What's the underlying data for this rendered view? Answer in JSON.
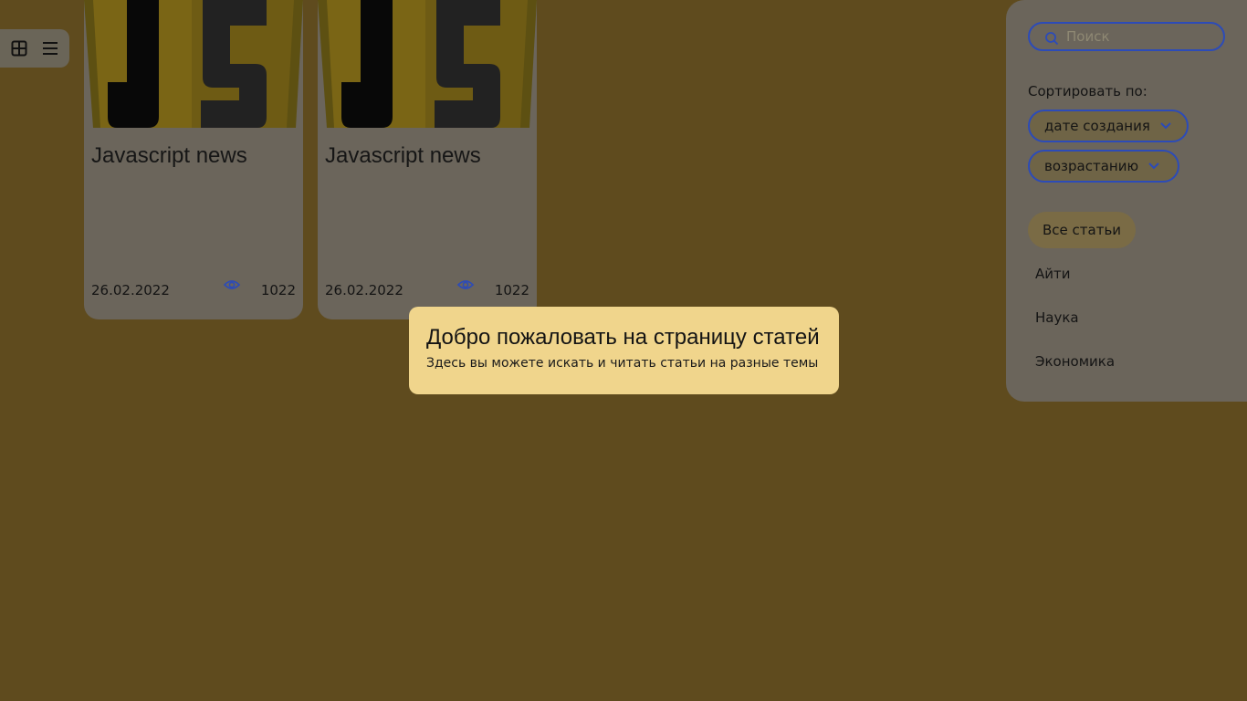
{
  "view_switch": {
    "tile_icon": "grid-view-icon",
    "list_icon": "list-view-icon"
  },
  "articles": [
    {
      "image": "javascript-logo",
      "title": "Javascript news",
      "date": "26.02.2022",
      "views_icon": "eye-icon",
      "views": "1022"
    },
    {
      "image": "javascript-logo",
      "title": "Javascript news",
      "date": "26.02.2022",
      "views_icon": "eye-icon",
      "views": "1022"
    }
  ],
  "sidebar": {
    "search": {
      "placeholder": "Поиск",
      "value": "",
      "icon": "search-icon"
    },
    "sort_label": "Сортировать по:",
    "sort_field": "дате создания",
    "sort_order": "возрастанию",
    "tabs": [
      {
        "label": "Все статьи",
        "active": true
      },
      {
        "label": "Айти",
        "active": false
      },
      {
        "label": "Наука",
        "active": false
      },
      {
        "label": "Экономика",
        "active": false
      }
    ]
  },
  "toast": {
    "title": "Добро пожаловать на страницу статей",
    "text": "Здесь вы можете искать и читать статьи на разные темы"
  },
  "colors": {
    "overlay_background": "#5f4b1e",
    "card_background": "#6b655b",
    "accent": "#2c4bb8",
    "toast_background": "#f0d58c",
    "logo_yellow": "#7a6515",
    "logo_dark": "#222222"
  }
}
